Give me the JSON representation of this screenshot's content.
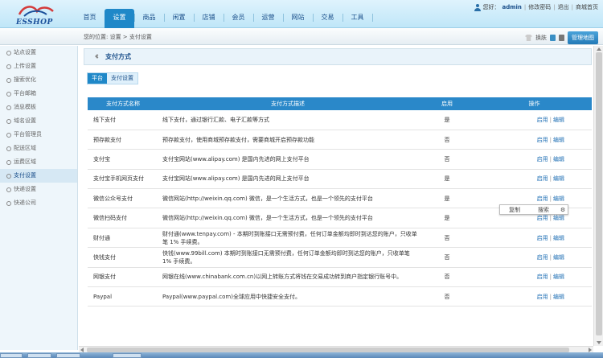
{
  "logo": {
    "text": "ESSHOP"
  },
  "nav": [
    {
      "label": "首页"
    },
    {
      "label": "设置"
    },
    {
      "label": "商品"
    },
    {
      "label": "闲置"
    },
    {
      "label": "店铺"
    },
    {
      "label": "会员"
    },
    {
      "label": "运营"
    },
    {
      "label": "网站"
    },
    {
      "label": "交易"
    },
    {
      "label": "工具"
    }
  ],
  "user": {
    "greeting": "您好：",
    "name": "admin",
    "links": [
      "修改密码",
      "退出",
      "商城首页"
    ]
  },
  "breadcrumb": "您的位置: 设置 > 支付设置",
  "tools": {
    "skin_label": "换肤",
    "sitemap_label": "管理地图"
  },
  "sidebar": [
    {
      "label": "站点设置"
    },
    {
      "label": "上传设置"
    },
    {
      "label": "搜索优化"
    },
    {
      "label": "平台邮箱"
    },
    {
      "label": "消息模板"
    },
    {
      "label": "域名设置"
    },
    {
      "label": "平台管理员"
    },
    {
      "label": "配送区域"
    },
    {
      "label": "运费区域"
    },
    {
      "label": "支付设置"
    },
    {
      "label": "快递设置"
    },
    {
      "label": "快递公司"
    }
  ],
  "main": {
    "title": "支付方式",
    "tabs": [
      {
        "label": "平台"
      },
      {
        "label": "支付设置"
      }
    ],
    "columns": [
      "支付方式名称",
      "支付方式描述",
      "启用",
      "操作"
    ],
    "op_labels": {
      "use": "启用",
      "edit": "编辑"
    },
    "rows": [
      {
        "name": "线下支付",
        "desc": "线下支付，通过银行汇款、电子汇款等方式",
        "enabled": "是"
      },
      {
        "name": "预存款支付",
        "desc": "预存款支付，使用商城预存款支付，需要商城开启预存款功能",
        "enabled": "否"
      },
      {
        "name": "支付宝",
        "desc": "支付宝网站(www.alipay.com) 是国内先进的网上支付平台",
        "enabled": "否"
      },
      {
        "name": "支付宝手机网页支付",
        "desc": "支付宝网站(www.alipay.com) 是国内先进的网上支付平台",
        "enabled": "是"
      },
      {
        "name": "微信公众号支付",
        "desc": "微信网站(http://weixin.qq.com) 微信，是一个生活方式，也是一个领先的支付平台",
        "enabled": "是"
      },
      {
        "name": "微信扫码支付",
        "desc": "微信网站(http://weixin.qq.com) 微信，是一个生活方式，也是一个领先的支付平台",
        "enabled": "是"
      },
      {
        "name": "财付通",
        "desc": "财付通(www.tenpay.com) - 本期时到账接口无需预付费，任何订单金额均即时到达您的账户，只收单笔 1% 手续费。",
        "enabled": "否"
      },
      {
        "name": "快钱支付",
        "desc": "快钱(www.99bill.com) 本期时到账接口无需预付费，任何订单金额均即时到达您的账户，只收单笔 1% 手续费。",
        "enabled": "否"
      },
      {
        "name": "网银支付",
        "desc": "网银在线(www.chinabank.com.cn)以网上转账方式将钱在交易成功转到商户指定银行账号中。",
        "enabled": "否"
      },
      {
        "name": "Paypal",
        "desc": "Paypal(www.paypal.com)全球应用中快捷安全支付。",
        "enabled": "否"
      }
    ]
  },
  "popup": {
    "copy": "复制",
    "search": "搜索"
  }
}
